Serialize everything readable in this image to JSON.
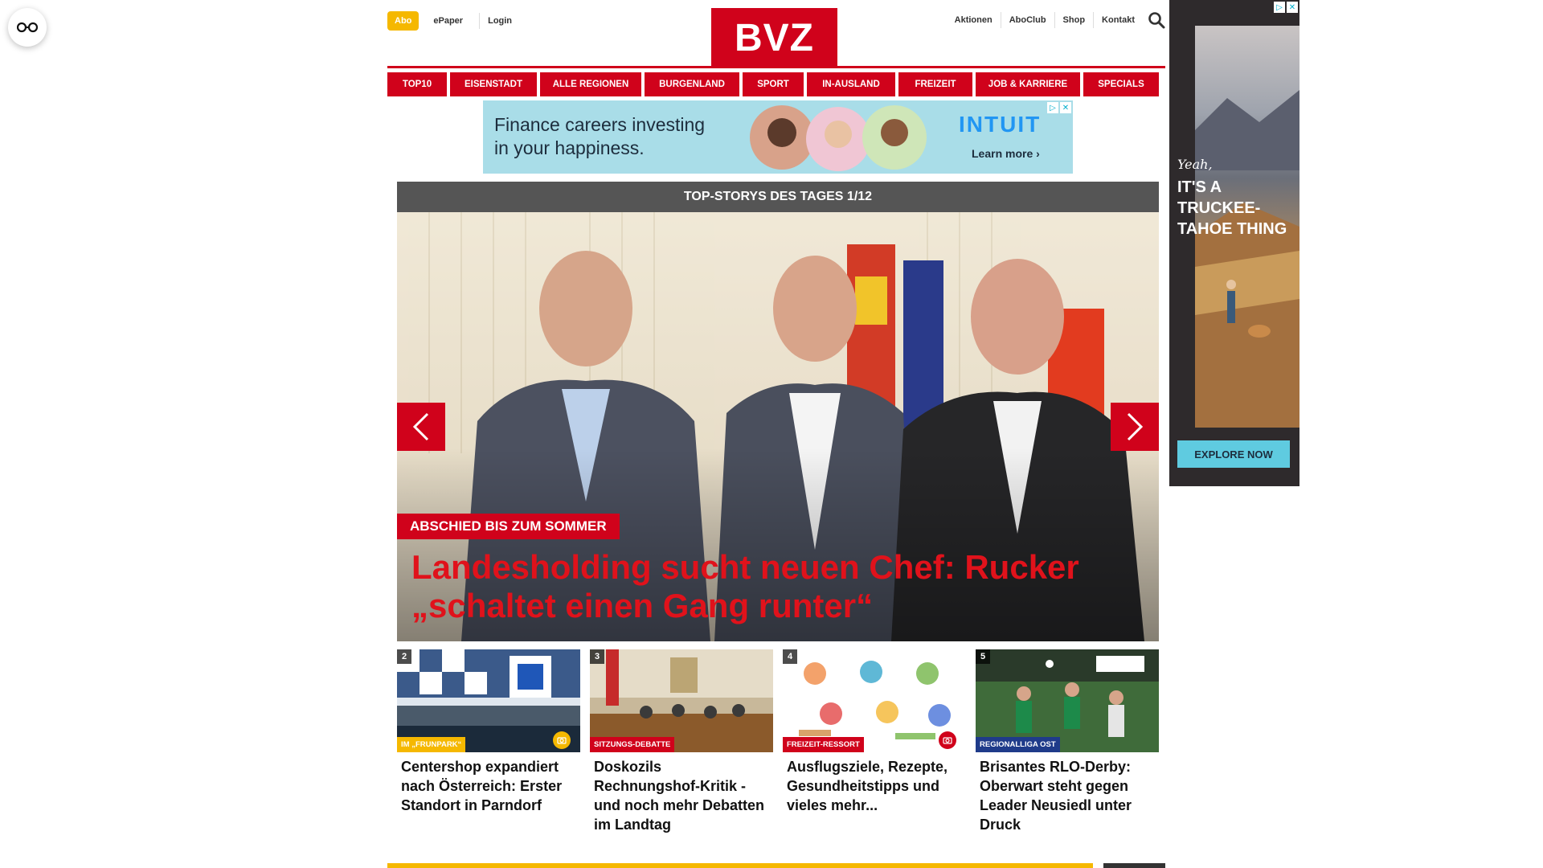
{
  "header": {
    "abo_label": "Abo",
    "left_links": [
      "ePaper",
      "Login"
    ],
    "logo_text": "BVZ",
    "right_links": [
      "Aktionen",
      "AboClub",
      "Shop",
      "Kontakt"
    ],
    "search_icon": "search-icon"
  },
  "nav": {
    "items": [
      "TOP10",
      "EISENSTADT",
      "ALLE REGIONEN",
      "BURGENLAND",
      "SPORT",
      "IN-AUSLAND",
      "FREIZEIT",
      "JOB & KARRIERE",
      "SPECIALS"
    ]
  },
  "ad_banner": {
    "line1": "Finance careers investing",
    "line2": "in your happiness.",
    "brand": "INTUIT",
    "cta": "Learn more ›"
  },
  "slider": {
    "header": "TOP-STORYS DES TAGES 1/12",
    "kicker": "ABSCHIED BIS ZUM SOMMER",
    "headline": "Landesholding sucht neuen Chef: Rucker „schaltet einen Gang runter“"
  },
  "teasers": [
    {
      "number": "2",
      "tag": "IM „FRUNPARK“",
      "title": "Centershop expandiert nach Österreich: Erster Standort in Parndorf",
      "tag_color": "#f5b800"
    },
    {
      "number": "3",
      "tag": "SITZUNGS-DEBATTE",
      "title": "Doskozils Rechnungshof-Kritik - und noch mehr Debatten im Landtag",
      "tag_color": "#d0021b"
    },
    {
      "number": "4",
      "tag": "FREIZEIT-RESSORT",
      "title": "Ausflugsziele, Rezepte, Gesundheitstipps und vieles mehr...",
      "tag_color": "#d0021b"
    },
    {
      "number": "5",
      "tag": "REGIONALLIGA OST",
      "title": "Brisantes RLO-Derby: Oberwart steht gegen Leader Neusiedl unter Druck",
      "tag_color": "#1f3b8a"
    }
  ],
  "side_ad": {
    "script_text": "Yeah,",
    "slogan": "IT'S A TRUCKEE-TAHOE THING",
    "cta": "EXPLORE NOW"
  },
  "colors": {
    "brand_red": "#d0021b",
    "abo_yellow": "#f5b800"
  }
}
